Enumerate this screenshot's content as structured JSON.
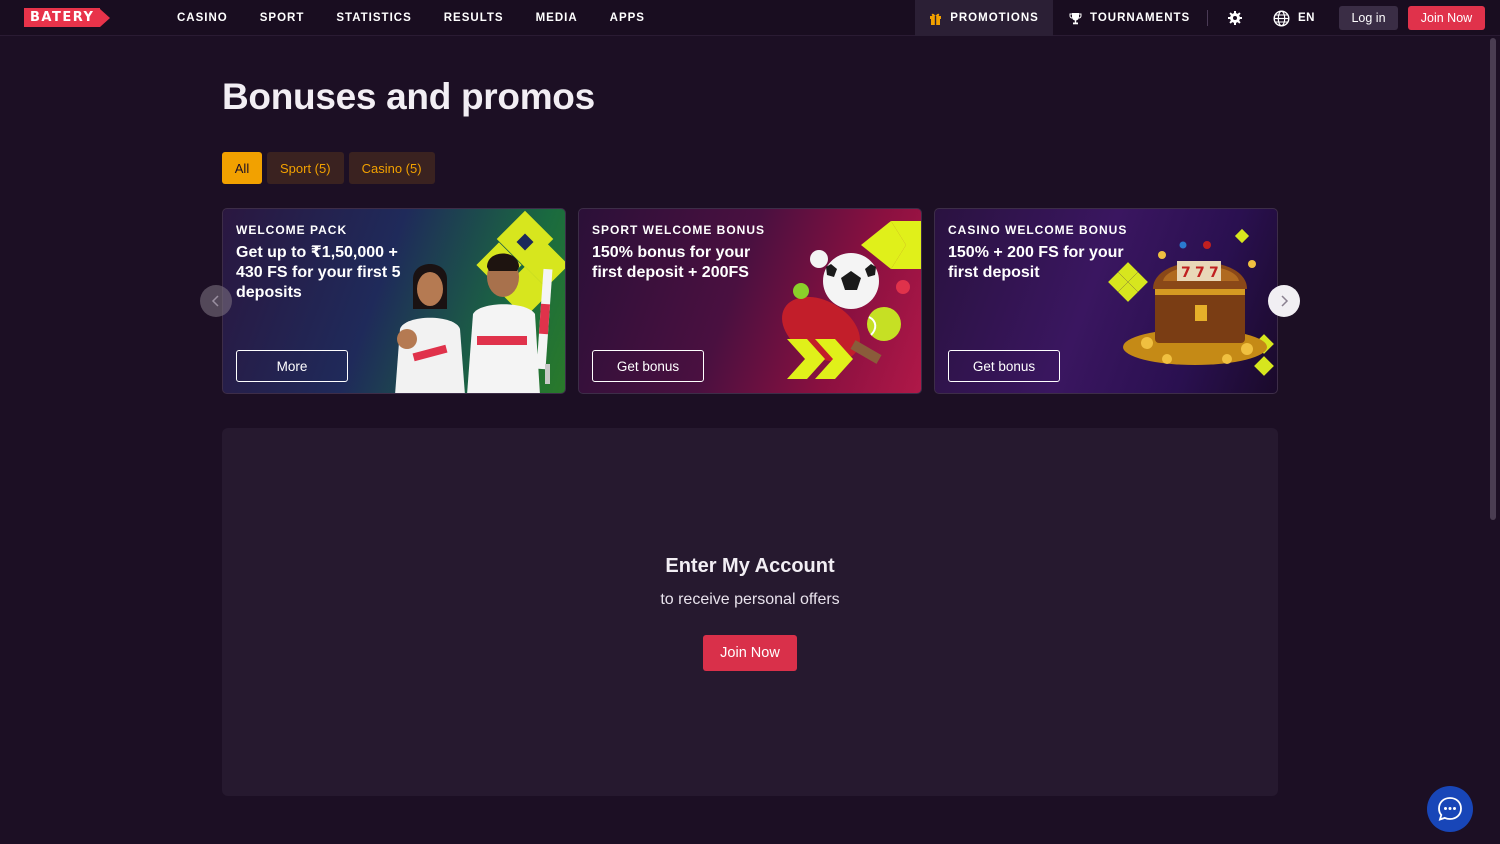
{
  "header": {
    "logo_text": "BATERY",
    "nav": [
      "CASINO",
      "SPORT",
      "STATISTICS",
      "RESULTS",
      "MEDIA",
      "APPS"
    ],
    "promotions_label": "PROMOTIONS",
    "tournaments_label": "TOURNAMENTS",
    "language": "EN",
    "login_label": "Log in",
    "join_label": "Join Now"
  },
  "page": {
    "title": "Bonuses and promos"
  },
  "filters": [
    {
      "label": "All",
      "active": true
    },
    {
      "label": "Sport (5)",
      "active": false
    },
    {
      "label": "Casino (5)",
      "active": false
    }
  ],
  "cards": [
    {
      "tag": "WELCOME PACK",
      "text": "Get up to ₹1,50,000 + 430 FS for your first 5 deposits",
      "button": "More"
    },
    {
      "tag": "SPORT WELCOME BONUS",
      "text": "150% bonus for your first deposit + 200FS",
      "button": "Get bonus"
    },
    {
      "tag": "CASINO WELCOME BONUS",
      "text": "150% + 200 FS for your first deposit",
      "button": "Get bonus"
    }
  ],
  "account": {
    "title": "Enter My Account",
    "subtitle": "to receive personal offers",
    "join_label": "Join Now"
  },
  "colors": {
    "background": "#1c0f24",
    "accent_red": "#e0324b",
    "accent_orange": "#f2a100",
    "panel": "#26192f",
    "chat": "#1846b8"
  },
  "icons": {
    "promotions": "gift-icon",
    "tournaments": "trophy-icon",
    "settings": "gear-icon",
    "language": "globe-icon",
    "chat": "chat-bubble-icon",
    "arrow_left": "chevron-left-icon",
    "arrow_right": "chevron-right-icon"
  }
}
